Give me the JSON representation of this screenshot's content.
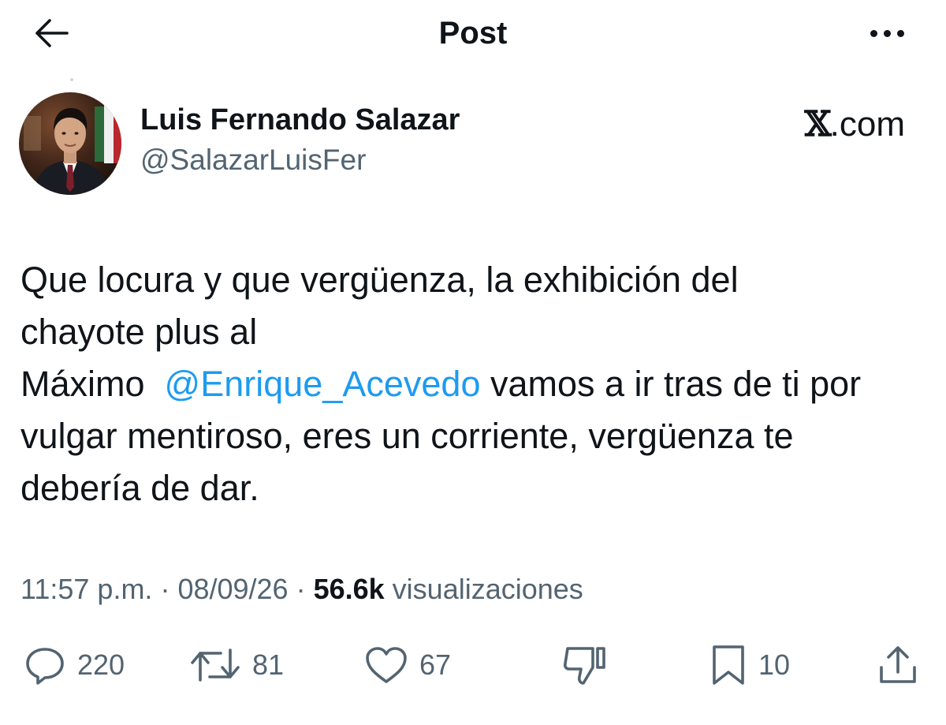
{
  "header": {
    "title": "Post",
    "back_icon": "arrow-left-icon",
    "more_icon": "more-horizontal-icon"
  },
  "author": {
    "name": "Luis Fernando Salazar",
    "handle": "@SalazarLuisFer"
  },
  "watermark": {
    "x": "𝕏",
    "domain": ".com"
  },
  "tweet": {
    "line1": "Que locura y que vergüenza, la exhibición del",
    "line2": "chayote plus al",
    "line3_before": "Máximo ",
    "mention": "@Enrique_Acevedo",
    "line3_after": " vamos a ir tras de ti por",
    "line4": "vulgar mentiroso, eres un corriente, vergüenza te",
    "line5": "debería de dar."
  },
  "meta": {
    "time": "11:57 p.m.",
    "separator": " · ",
    "date": "08/09/26",
    "views_count": "56.6k",
    "views_label": " visualizaciones"
  },
  "actions": {
    "replies": "220",
    "reposts": "81",
    "likes": "67",
    "bookmarks": "10"
  },
  "colors": {
    "text": "#0f1419",
    "secondary": "#536471",
    "link": "#1d9bf0"
  }
}
